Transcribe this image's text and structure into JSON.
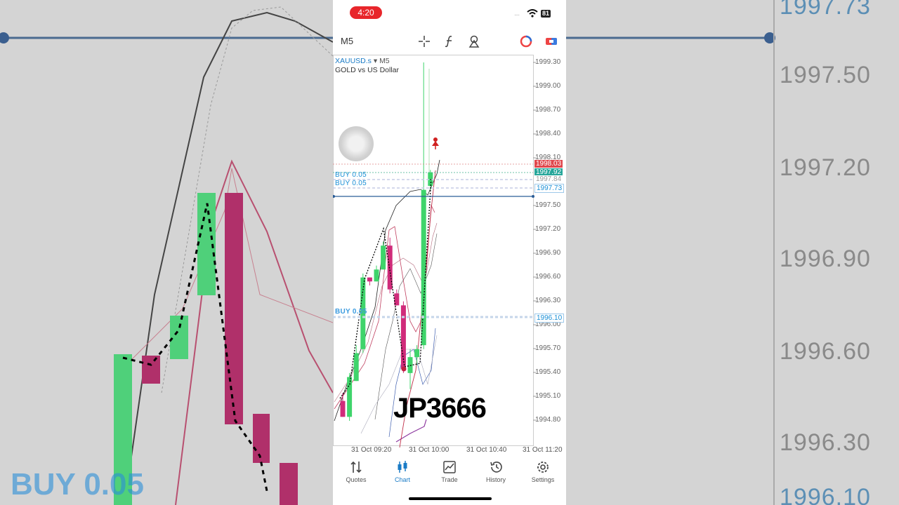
{
  "status": {
    "time": "4:20",
    "signal": "....",
    "battery": "81"
  },
  "toolbar": {
    "timeframe": "M5",
    "icons": [
      "crosshair-icon",
      "function-icon",
      "objects-icon",
      "account-icon",
      "trade-toggle-icon"
    ]
  },
  "chart": {
    "symbol": "XAUUSD.s",
    "symbol_tf": "M5",
    "description": "GOLD vs US Dollar",
    "y_ticks": [
      "1999.30",
      "1999.00",
      "1998.70",
      "1998.40",
      "1998.10",
      "1997.50",
      "1997.20",
      "1996.90",
      "1996.60",
      "1996.30",
      "1996.00",
      "1995.70",
      "1995.40",
      "1995.10",
      "1994.80"
    ],
    "price_boxes": {
      "ask": "1998.03",
      "bid": "1997.92",
      "level1": "1997.84",
      "level2": "1997.73",
      "level3": "1996.10"
    },
    "position_labels": [
      "BUY 0.05",
      "BUY 0.05",
      "BUY 0.05"
    ],
    "x_ticks": [
      "31 Oct 09:20",
      "31 Oct 10:00",
      "31 Oct 10:40",
      "31 Oct 11:20"
    ],
    "colors": {
      "bull": "#3fd46b",
      "bear": "#d02b7a",
      "ask": "#e0474c",
      "bid": "#26a69a",
      "accent": "#1a7bc6"
    }
  },
  "chart_data": {
    "type": "candlestick",
    "title": "XAUUSD.s M5",
    "candles": [
      {
        "o": 1995.05,
        "h": 1995.15,
        "l": 1994.85,
        "c": 1994.85
      },
      {
        "o": 1994.85,
        "h": 1995.4,
        "l": 1994.8,
        "c": 1995.35
      },
      {
        "o": 1995.3,
        "h": 1995.75,
        "l": 1995.3,
        "c": 1995.65
      },
      {
        "o": 1995.7,
        "h": 1996.65,
        "l": 1995.65,
        "c": 1996.6
      },
      {
        "o": 1996.6,
        "h": 1996.6,
        "l": 1996.5,
        "c": 1996.55
      },
      {
        "o": 1996.55,
        "h": 1996.75,
        "l": 1996.55,
        "c": 1996.7
      },
      {
        "o": 1996.7,
        "h": 1997.05,
        "l": 1996.7,
        "c": 1997.0
      },
      {
        "o": 1997.0,
        "h": 1997.1,
        "l": 1996.4,
        "c": 1996.45
      },
      {
        "o": 1996.4,
        "h": 1996.45,
        "l": 1996.25,
        "c": 1996.25
      },
      {
        "o": 1996.25,
        "h": 1996.3,
        "l": 1995.4,
        "c": 1995.45
      },
      {
        "o": 1995.4,
        "h": 1995.7,
        "l": 1995.2,
        "c": 1995.6
      },
      {
        "o": 1995.6,
        "h": 1995.75,
        "l": 1995.5,
        "c": 1995.7
      },
      {
        "o": 1995.75,
        "h": 1999.3,
        "l": 1995.7,
        "c": 1997.7
      },
      {
        "o": 1997.75,
        "h": 1997.95,
        "l": 1997.7,
        "c": 1997.92
      }
    ],
    "ylim": [
      1994.8,
      1999.3
    ],
    "annotations": {
      "horizontal_line": 1997.64,
      "buy_level": 1996.1,
      "sell_arrow": 1998.4
    }
  },
  "watermark": "JP3666",
  "tabs": [
    {
      "label": "Quotes",
      "icon": "quotes-icon"
    },
    {
      "label": "Chart",
      "icon": "chart-icon",
      "active": true
    },
    {
      "label": "Trade",
      "icon": "trade-icon"
    },
    {
      "label": "History",
      "icon": "history-icon"
    },
    {
      "label": "Settings",
      "icon": "settings-icon"
    }
  ],
  "background": {
    "right_labels": [
      "1997.73",
      "1997.50",
      "1997.20",
      "1996.90",
      "1996.60",
      "1996.30",
      "1996.10"
    ],
    "left_label": "BUY 0.05"
  }
}
